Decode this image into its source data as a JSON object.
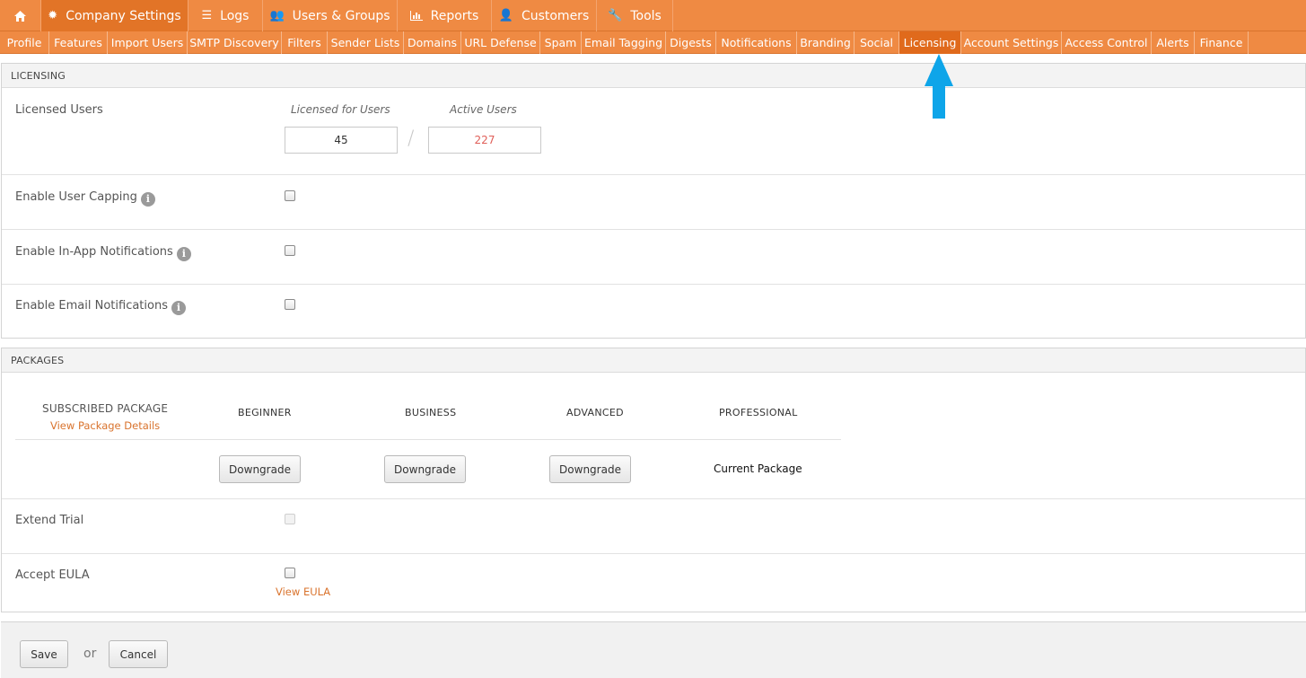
{
  "topnav": {
    "home_icon": "home-icon",
    "tabs": [
      {
        "label": "Company Settings",
        "icon": "gear-icon"
      },
      {
        "label": "Logs",
        "icon": "list-icon"
      },
      {
        "label": "Users & Groups",
        "icon": "users-icon"
      },
      {
        "label": "Reports",
        "icon": "bar-chart-icon"
      },
      {
        "label": "Customers",
        "icon": "user-icon"
      },
      {
        "label": "Tools",
        "icon": "wrench-icon"
      }
    ]
  },
  "subnav": {
    "items": [
      "Profile",
      "Features",
      "Import Users",
      "SMTP Discovery",
      "Filters",
      "Sender Lists",
      "Domains",
      "URL Defense",
      "Spam",
      "Email Tagging",
      "Digests",
      "Notifications",
      "Branding",
      "Social",
      "Licensing",
      "Account Settings",
      "Access Control",
      "Alerts",
      "Finance"
    ],
    "active": "Licensing"
  },
  "licensing": {
    "section_title": "LICENSING",
    "licensed_users_label": "Licensed Users",
    "licensed_for_users_caption": "Licensed for Users",
    "active_users_caption": "Active Users",
    "licensed_for_users_value": "45",
    "separator": "/",
    "active_users_value": "227",
    "enable_user_capping_label": "Enable User Capping",
    "enable_inapp_notifications_label": "Enable In-App Notifications",
    "enable_email_notifications_label": "Enable Email Notifications",
    "info_glyph": "i"
  },
  "packages": {
    "section_title": "PACKAGES",
    "subscribed_package_label": "SUBSCRIBED PACKAGE",
    "view_package_details": "View Package Details",
    "columns": [
      "BEGINNER",
      "BUSINESS",
      "ADVANCED",
      "PROFESSIONAL"
    ],
    "actions": [
      "Downgrade",
      "Downgrade",
      "Downgrade"
    ],
    "current_package_label": "Current Package",
    "extend_trial_label": "Extend Trial",
    "accept_eula_label": "Accept EULA",
    "view_eula": "View EULA"
  },
  "footer": {
    "save_label": "Save",
    "or_label": "or",
    "cancel_label": "Cancel"
  },
  "colors": {
    "nav_orange": "#ef8a43",
    "active_tab": "#e06a1c",
    "link": "#d9732d",
    "active_users_text": "#e0605a",
    "arrow": "#0ea5e9"
  }
}
